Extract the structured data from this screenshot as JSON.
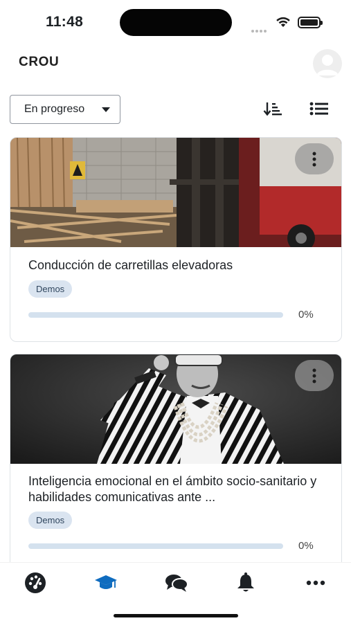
{
  "status_bar": {
    "time": "11:48"
  },
  "header": {
    "title": "CROU"
  },
  "toolbar": {
    "filter_value": "En progreso"
  },
  "courses": [
    {
      "title": "Conducción de carretillas elevadoras",
      "category": "Demos",
      "progress_text": "0%",
      "progress": 0,
      "image_icon": "forklift-warehouse-photo"
    },
    {
      "title": "Inteligencia emocional en el ámbito socio-sanitario y habilidades comunicativas ante ...",
      "category": "Demos",
      "progress_text": "0%",
      "progress": 0,
      "image_icon": "elderly-woman-portrait-photo"
    }
  ],
  "tabs": [
    {
      "icon": "dashboard-icon",
      "active": false
    },
    {
      "icon": "graduation-cap-icon",
      "active": true
    },
    {
      "icon": "chat-icon",
      "active": false
    },
    {
      "icon": "bell-icon",
      "active": false
    },
    {
      "icon": "more-icon",
      "active": false
    }
  ],
  "colors": {
    "accent": "#0f6cbf",
    "badge_bg": "#dae4f0",
    "progress_track": "#d4e1ee",
    "text": "#1d2125"
  }
}
